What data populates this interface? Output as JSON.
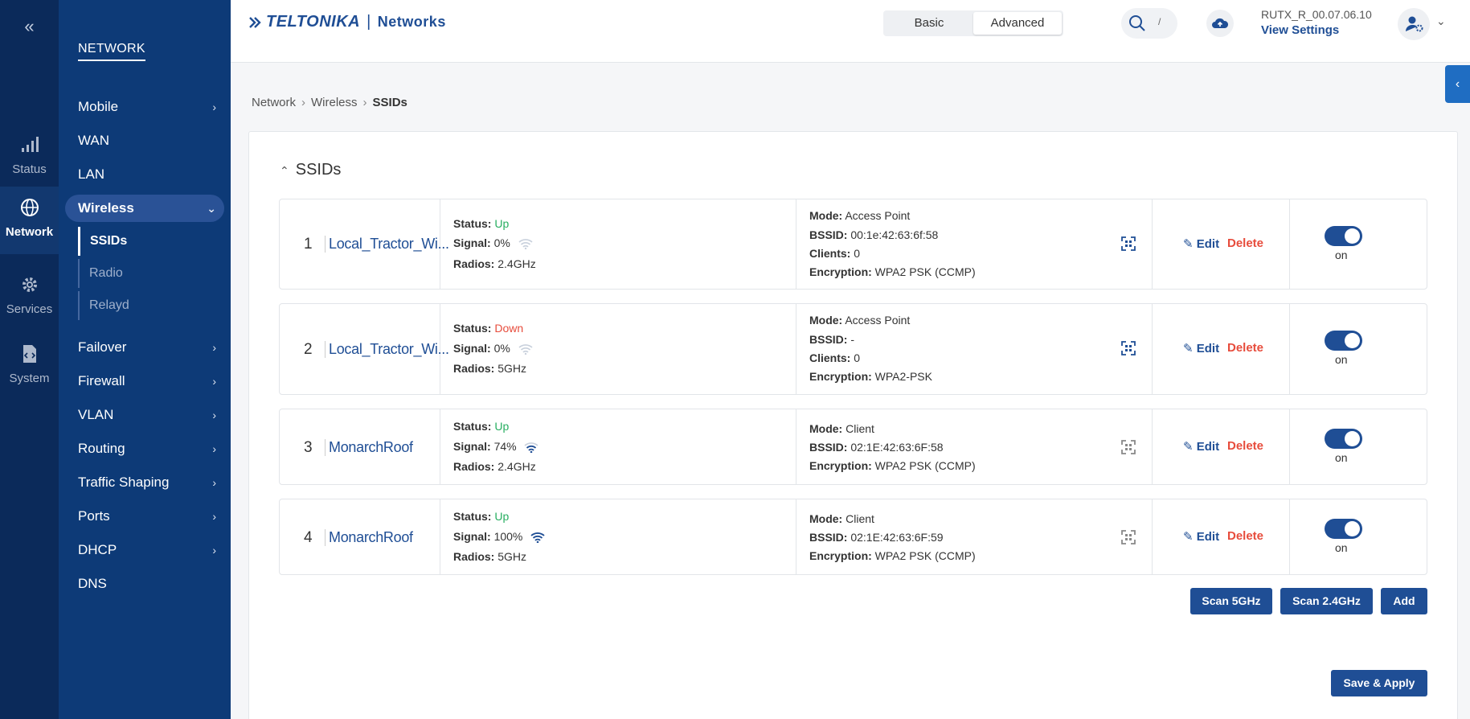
{
  "rail": {
    "collapse_label": "«",
    "items": [
      {
        "label": "Status",
        "icon": "signal-bars-icon"
      },
      {
        "label": "Network",
        "icon": "globe-icon"
      },
      {
        "label": "Services",
        "icon": "gear-icon"
      },
      {
        "label": "System",
        "icon": "system-file-icon"
      }
    ]
  },
  "side": {
    "title": "NETWORK",
    "items": [
      "Mobile",
      "WAN",
      "LAN",
      "Wireless",
      "Failover",
      "Firewall",
      "VLAN",
      "Routing",
      "Traffic Shaping",
      "Ports",
      "DHCP",
      "DNS"
    ],
    "sub_items": [
      "SSIDs",
      "Radio",
      "Relayd"
    ]
  },
  "header": {
    "brand": "TELTONIKA",
    "brand_sep": "|",
    "brand_suffix": "Networks",
    "mode_basic": "Basic",
    "mode_advanced": "Advanced",
    "search_hint": "/",
    "firmware": "RUTX_R_00.07.06.10",
    "view_settings": "View Settings"
  },
  "breadcrumb": {
    "a": "Network",
    "b": "Wireless",
    "c": "SSIDs"
  },
  "section": {
    "title": "SSIDs"
  },
  "labels": {
    "status": "Status:",
    "signal": "Signal:",
    "radios": "Radios:",
    "mode": "Mode:",
    "bssid": "BSSID:",
    "clients": "Clients:",
    "encryption": "Encryption:",
    "edit": "Edit",
    "delete": "Delete",
    "on": "on"
  },
  "rows": [
    {
      "num": "1",
      "ssid": "Local_Tractor_Wi...",
      "status": "Up",
      "signal": "0%",
      "radios": "2.4GHz",
      "mode": "Access Point",
      "bssid": "00:1e:42:63:6f:58",
      "clients": "0",
      "encryption": "WPA2 PSK (CCMP)"
    },
    {
      "num": "2",
      "ssid": "Local_Tractor_Wi...",
      "status": "Down",
      "signal": "0%",
      "radios": "5GHz",
      "mode": "Access Point",
      "bssid": "-",
      "clients": "0",
      "encryption": "WPA2-PSK"
    },
    {
      "num": "3",
      "ssid": "MonarchRoof",
      "status": "Up",
      "signal": "74%",
      "radios": "2.4GHz",
      "mode": "Client",
      "bssid": "02:1E:42:63:6F:58",
      "encryption": "WPA2 PSK (CCMP)"
    },
    {
      "num": "4",
      "ssid": "MonarchRoof",
      "status": "Up",
      "signal": "100%",
      "radios": "5GHz",
      "mode": "Client",
      "bssid": "02:1E:42:63:6F:59",
      "encryption": "WPA2 PSK (CCMP)"
    }
  ],
  "buttons": {
    "scan5": "Scan 5GHz",
    "scan24": "Scan 2.4GHz",
    "add": "Add",
    "save": "Save & Apply"
  },
  "colors": {
    "primary": "#1f4e95",
    "up": "#27ae60",
    "down": "#e74c3c",
    "sidebar": "#0d3a77"
  }
}
